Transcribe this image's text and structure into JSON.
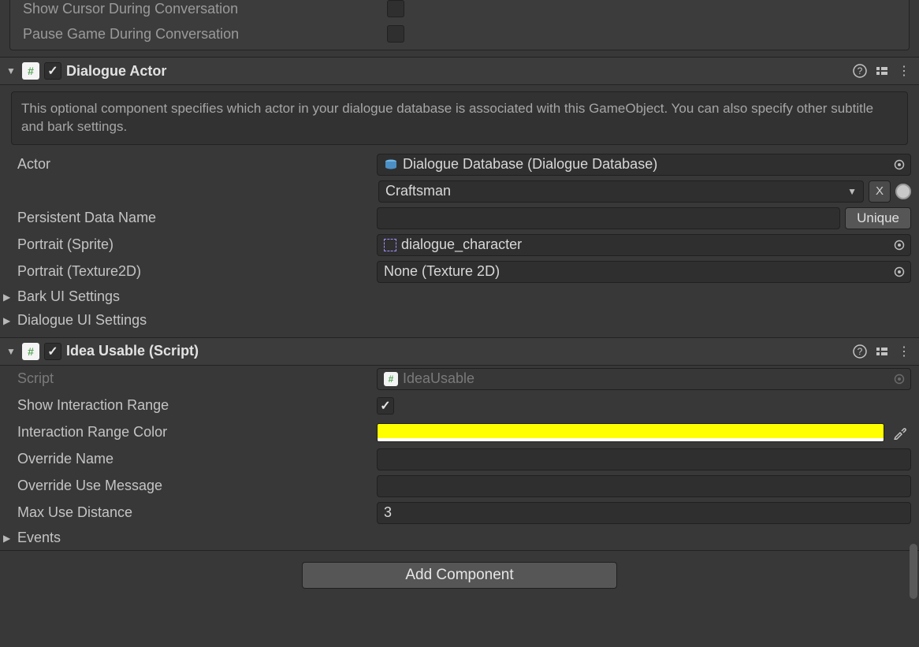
{
  "top": {
    "show_cursor_label": "Show Cursor During Conversation",
    "pause_game_label": "Pause Game During Conversation"
  },
  "dialogue_actor": {
    "title": "Dialogue Actor",
    "help_text": "This optional component specifies which actor in your dialogue database is associated with this GameObject. You can also specify other subtitle and bark settings.",
    "actor_label": "Actor",
    "actor_db_value": "Dialogue Database (Dialogue Database)",
    "actor_selected": "Craftsman",
    "actor_x_label": "X",
    "persistent_label": "Persistent Data Name",
    "persistent_value": "",
    "unique_label": "Unique",
    "portrait_sprite_label": "Portrait (Sprite)",
    "portrait_sprite_value": "dialogue_character",
    "portrait_tex_label": "Portrait (Texture2D)",
    "portrait_tex_value": "None (Texture 2D)",
    "bark_label": "Bark UI Settings",
    "dialogue_ui_label": "Dialogue UI Settings"
  },
  "idea_usable": {
    "title": "Idea Usable (Script)",
    "script_label": "Script",
    "script_value": "IdeaUsable",
    "show_range_label": "Show Interaction Range",
    "range_color_label": "Interaction Range Color",
    "range_color": "#ffff00",
    "override_name_label": "Override Name",
    "override_name_value": "",
    "override_use_label": "Override Use Message",
    "override_use_value": "",
    "max_use_label": "Max Use Distance",
    "max_use_value": "3",
    "events_label": "Events"
  },
  "footer": {
    "add_component_label": "Add Component"
  }
}
